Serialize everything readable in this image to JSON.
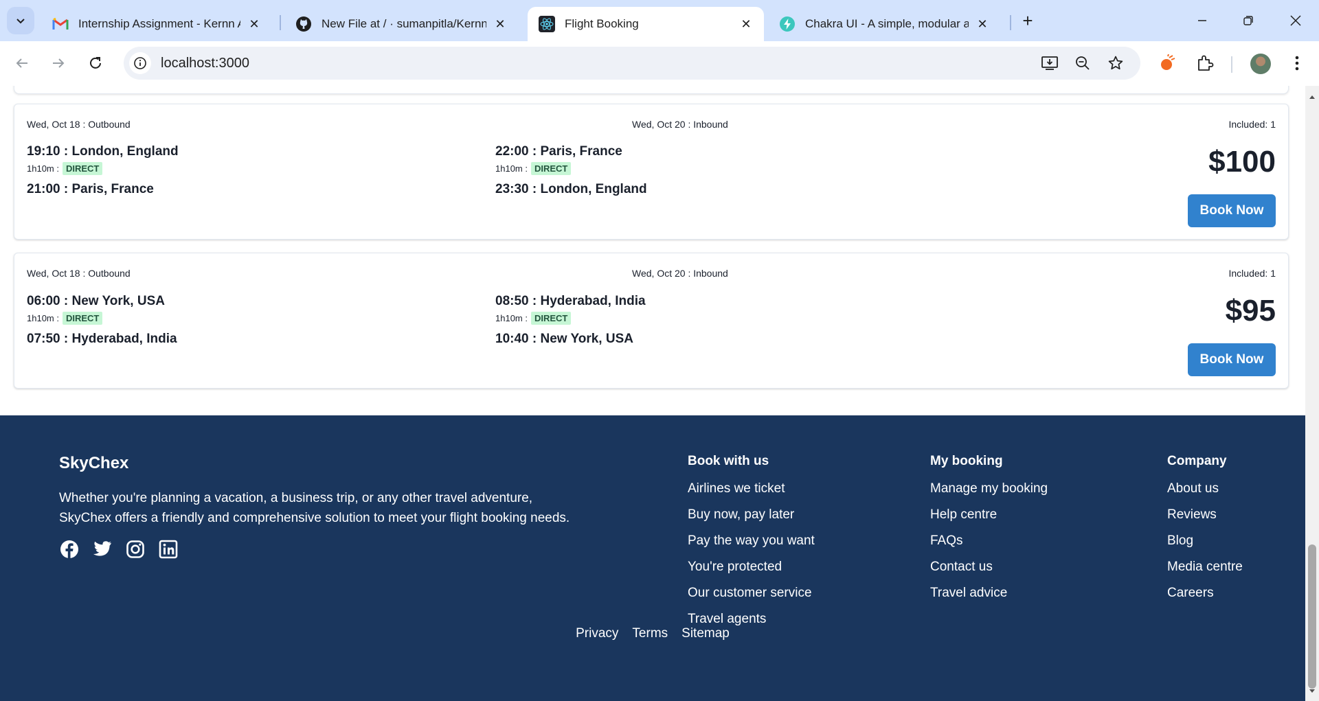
{
  "browser": {
    "tabs": [
      {
        "title": "Internship Assignment - Kernn Aut",
        "favicon": "gmail-icon"
      },
      {
        "title": "New File at / · sumanpitla/Kernn-a",
        "favicon": "github-icon"
      },
      {
        "title": "Flight Booking",
        "favicon": "react-icon",
        "active": true
      },
      {
        "title": "Chakra UI - A simple, modular and",
        "favicon": "chakra-icon"
      }
    ],
    "url": "localhost:3000"
  },
  "flights": [
    {
      "outbound_date": "Wed, Oct 18 : Outbound",
      "inbound_date": "Wed, Oct 20 : Inbound",
      "included": "Included: 1",
      "outbound": {
        "depart": "19:10 : London, England",
        "duration": "1h10m :",
        "stops": "DIRECT",
        "arrive": "21:00 : Paris, France"
      },
      "inbound": {
        "depart": "22:00 : Paris, France",
        "duration": "1h10m :",
        "stops": "DIRECT",
        "arrive": "23:30 : London, England"
      },
      "price": "$100",
      "book_label": "Book Now"
    },
    {
      "outbound_date": "Wed, Oct 18 : Outbound",
      "inbound_date": "Wed, Oct 20 : Inbound",
      "included": "Included: 1",
      "outbound": {
        "depart": "06:00 : New York, USA",
        "duration": "1h10m :",
        "stops": "DIRECT",
        "arrive": "07:50 : Hyderabad, India"
      },
      "inbound": {
        "depart": "08:50 : Hyderabad, India",
        "duration": "1h10m :",
        "stops": "DIRECT",
        "arrive": "10:40 : New York, USA"
      },
      "price": "$95",
      "book_label": "Book Now"
    }
  ],
  "footer": {
    "brand": "SkyChex",
    "tagline_line1": "Whether you're planning a vacation, a business trip, or any other travel adventure,",
    "tagline_line2": "SkyChex offers a friendly and comprehensive solution to meet your flight booking needs.",
    "social_icons": [
      "facebook-icon",
      "twitter-icon",
      "instagram-icon",
      "linkedin-icon"
    ],
    "columns": [
      {
        "heading": "Book with us",
        "links": [
          "Airlines we ticket",
          "Buy now, pay later",
          "Pay the way you want",
          "You're protected",
          "Our customer service",
          "Travel agents"
        ]
      },
      {
        "heading": "My booking",
        "links": [
          "Manage my booking",
          "Help centre",
          "FAQs",
          "Contact us",
          "Travel advice"
        ]
      },
      {
        "heading": "Company",
        "links": [
          "About us",
          "Reviews",
          "Blog",
          "Media centre",
          "Careers"
        ]
      }
    ],
    "legal": [
      "Privacy",
      "Terms",
      "Sitemap"
    ]
  },
  "colors": {
    "footer_bg": "#1a365d",
    "primary_button": "#3182ce",
    "badge_bg": "#c6f6d5",
    "badge_text": "#22543d"
  }
}
